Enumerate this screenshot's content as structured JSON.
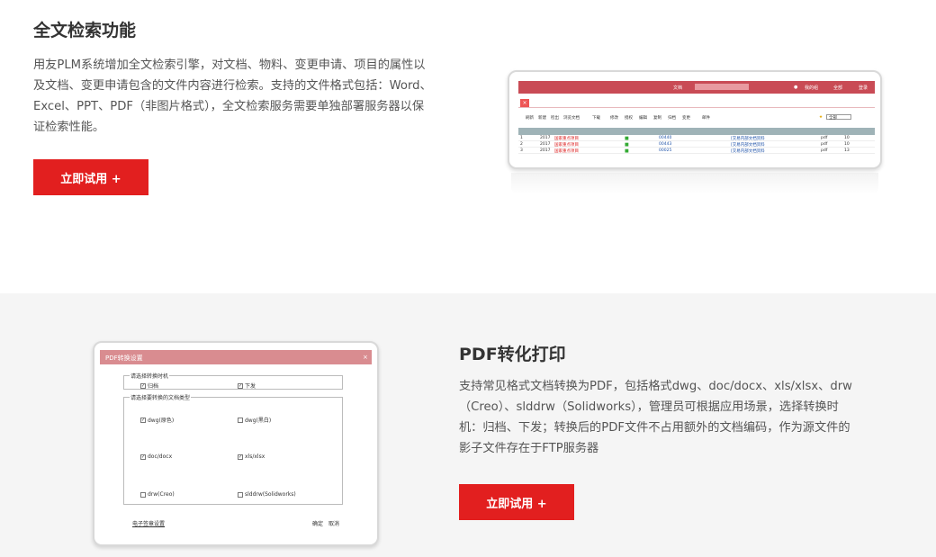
{
  "section1": {
    "title": "全文检索功能",
    "lines": [
      "用友PLM系统增加全文检索引擎，对文档、物料、变更申请、项目的属性以",
      "及文档、变更申请包含的文件内容进行检索。支持的文件格式包括：Word、",
      "Excel、PPT、PDF（非图片格式），全文检索服务需要单独部署服务器以保",
      "证检索性能。"
    ],
    "button": "立即试用 +"
  },
  "shot1": {
    "top_items": [
      "文档",
      "我的组",
      "全部",
      "登录"
    ],
    "toolbar": [
      "刷新",
      "新建",
      "检出",
      "浏览文档",
      "下载",
      "修改",
      "授权",
      "编辑",
      "复制",
      "归档",
      "变更",
      "邮件",
      "全部"
    ],
    "rows": [
      {
        "no": "1",
        "year": "2017",
        "name": "国家重点项目",
        "code": "00440",
        "desc": "[交易内部文档资料",
        "fmt": "pdf",
        "n": "10"
      },
      {
        "no": "2",
        "year": "2017",
        "name": "国家重点项目",
        "code": "00443",
        "desc": "[交易内部文档资料",
        "fmt": "pdf",
        "n": "10"
      },
      {
        "no": "3",
        "year": "2017",
        "name": "国家重点项目",
        "code": "00025",
        "desc": "[交易内部文档资料",
        "fmt": "pdf",
        "n": "13"
      }
    ]
  },
  "section2": {
    "title": "PDF转化打印",
    "lines": [
      "支持常见格式文档转换为PDF，包括格式dwg、doc/docx、xls/xlsx、drw",
      "（Creo）、slddrw（Solidworks），管理员可根据应用场景，选择转换时",
      "机：归档、下发；转换后的PDF文件不占用额外的文档编码，作为源文件的",
      "影子文件存在于FTP服务器"
    ],
    "button": "立即试用 +"
  },
  "shot2": {
    "title": "PDF转换设置",
    "group1": "请选择转换时机",
    "opt_archive": "归档",
    "opt_issue": "下发",
    "group2": "请选择要转换的文档类型",
    "types": [
      {
        "label": "dwg(原色)",
        "checked": true
      },
      {
        "label": "dwg(黑白)",
        "checked": false
      },
      {
        "label": "doc/docx",
        "checked": true
      },
      {
        "label": "xls/xlsx",
        "checked": true
      },
      {
        "label": "drw(Creo)",
        "checked": false
      },
      {
        "label": "slddrw(Solidworks)",
        "checked": false
      }
    ],
    "footer_link": "电子签章设置",
    "ok": "确定",
    "cancel": "取消"
  },
  "colors": {
    "accent": "#e21f1f",
    "section2_bg": "#f5f5f5"
  }
}
